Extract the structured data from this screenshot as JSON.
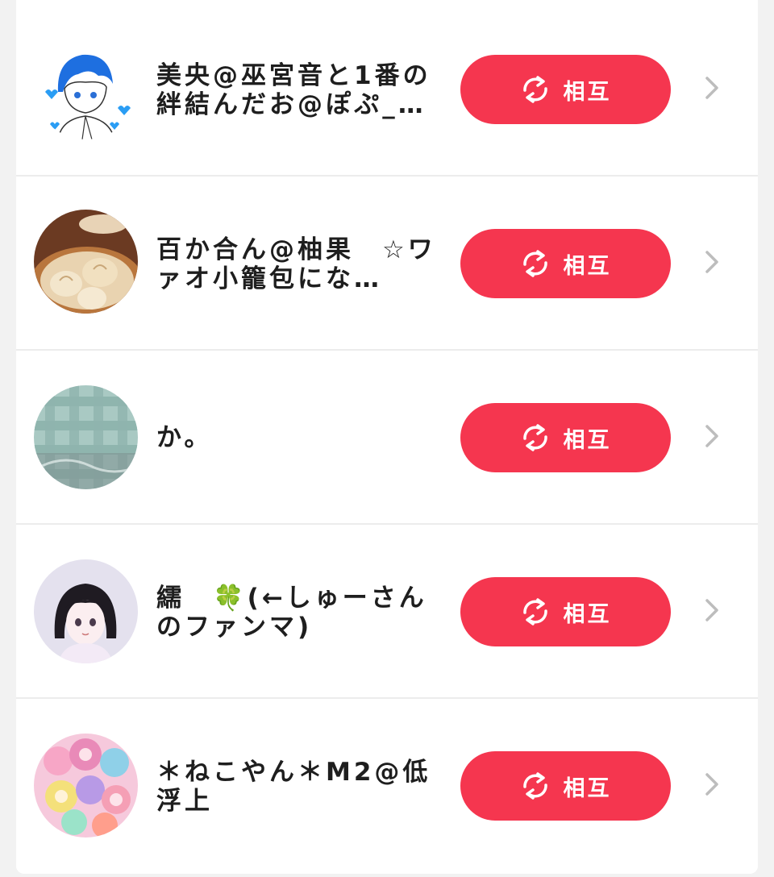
{
  "colors": {
    "button": "#f5364f",
    "button_text": "#ffffff",
    "chevron": "#bdbdbd",
    "name_text": "#1e1e1e"
  },
  "users": [
    {
      "name": "美央@巫宮音と1番の絆結んだお@ぽぷ_…",
      "button_label": "相互",
      "button_icon": "sync-icon",
      "avatar": "anime-boy-blue-hair-sketch"
    },
    {
      "name": "百か合ん@柚果　☆ワァオ小籠包にな…",
      "button_label": "相互",
      "button_icon": "sync-icon",
      "avatar": "xiaolongbao-dumplings"
    },
    {
      "name": "か。",
      "button_label": "相互",
      "button_icon": "sync-icon",
      "avatar": "teal-plaid-fabric"
    },
    {
      "name": "繻　🍀(←しゅーさんのファンマ)",
      "button_label": "相互",
      "button_icon": "sync-icon",
      "avatar": "anime-girl-black-bob"
    },
    {
      "name": "＊ねこやん＊M2@低浮上",
      "button_label": "相互",
      "button_icon": "sync-icon",
      "avatar": "colorful-anime-group"
    }
  ]
}
